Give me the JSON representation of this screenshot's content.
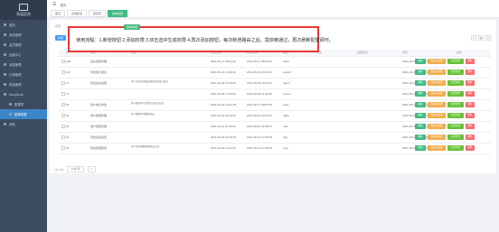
{
  "sidebar": {
    "brand": "华运后台",
    "items": [
      {
        "label": "首页",
        "active": false,
        "sub": false
      },
      {
        "label": "系统管理",
        "active": false,
        "sub": false
      },
      {
        "label": "会员管理",
        "active": false,
        "sub": false
      },
      {
        "label": "运营中心",
        "active": false,
        "sub": false
      },
      {
        "label": "消息管理",
        "active": false,
        "sub": false
      },
      {
        "label": "订单管理",
        "active": false,
        "sub": false
      },
      {
        "label": "资金管理",
        "active": false,
        "sub": false
      },
      {
        "label": "DeepBook",
        "active": false,
        "sub": false
      },
      {
        "label": "配置项",
        "active": false,
        "sub": true
      },
      {
        "label": "菜单权限",
        "active": true,
        "sub": true
      },
      {
        "label": "其他",
        "active": false,
        "sub": false
      }
    ]
  },
  "topbar": {
    "title": "首页"
  },
  "tabs": [
    {
      "label": "首页",
      "active": false
    },
    {
      "label": "系统配置",
      "active": false
    },
    {
      "label": "配置项",
      "active": false
    },
    {
      "label": "菜单权限",
      "active": true
    }
  ],
  "panel": {
    "filter_label": "名称",
    "add_label": "新增"
  },
  "callout": {
    "badge": "菜单权限",
    "text": "使用流程：1.新增按钮 2.添加权限 3.双击选中生成权限 4.再次添加按钮，每次新增路由之后，需依赖通过，再次刷新配置即可。"
  },
  "table": {
    "columns": [
      "ID",
      "名称",
      "描述",
      "创建时间",
      "更新时间",
      "路径",
      "状态",
      "权限标识",
      "排序",
      "操作"
    ],
    "rows": [
      {
        "id": "148",
        "name": "后台权限管理",
        "desc": "",
        "created": "2021-06-17 08:21:00",
        "updated": "2021-06-17 08:21:00",
        "path": "/auth",
        "status": "",
        "perm": "",
        "sort": "2021-06-17 08:21:00"
      },
      {
        "id": "147",
        "name": "导出统计报表",
        "desc": "",
        "created": "2021-05-21 15:40:26",
        "updated": "2021-05-21 15:40:26",
        "path": "/export",
        "status": "",
        "perm": "",
        "sort": "2021-05-21 15:40:26"
      },
      {
        "id": "71",
        "name": "导出后台权限",
        "desc": "用于导出后台路由权限列表的接口信息",
        "created": "2021-03-30 15:16:05",
        "updated": "2021-05-18 15:31:00",
        "path": "/perm",
        "status": "",
        "perm": "",
        "sort": "2021-05-18 15:31:00"
      },
      {
        "id": "70",
        "name": "",
        "desc": "",
        "created": "2021-03-18 17:09:04",
        "updated": "2021-05-18 11:34:05",
        "path": "/menu",
        "status": "",
        "perm": "",
        "sort": "2021-05-18 11:34:05"
      },
      {
        "id": "60",
        "name": "用户信息修改",
        "desc": "用于修改用户信息的后台接口信息",
        "created": "2021-03-18 13:21:48",
        "updated": "2021-05-17 08:57:00",
        "path": "/user",
        "status": "",
        "perm": "",
        "sort": "2021-05-17 08:57:00"
      },
      {
        "id": "61",
        "name": "用户数据管理",
        "desc": "用于管理用户数据的接口",
        "created": "2021-03-13 16:40:31",
        "updated": "2021-05-16 09:09:44",
        "path": "/data",
        "status": "",
        "perm": "",
        "sort": "2021-05-16 09:09:44"
      },
      {
        "id": "63",
        "name": "用户权限管理",
        "desc": "",
        "created": "2021-03-11 14:36:43",
        "updated": "2021-05-16 09:38:21",
        "path": "/role",
        "status": "",
        "perm": "",
        "sort": "2021-05-16 09:38:21"
      },
      {
        "id": "62",
        "name": "导出后台配置",
        "desc": "",
        "created": "2021-03-18 10:40:18",
        "updated": "2021-05-12 17:05:08",
        "path": "/cfg",
        "status": "",
        "perm": "",
        "sort": "2021-05-12 17:05:08"
      },
      {
        "id": "64",
        "name": "导出权限配置",
        "desc": "用于导出权限配置的接口信息",
        "created": "2021-01-20 11:21:02",
        "updated": "2021-05-12 17:08:08",
        "path": "/exp",
        "status": "",
        "perm": "",
        "sort": "2021-05-12 17:08:08"
      }
    ],
    "actions": {
      "edit": "编辑",
      "add_sub": "添加子权限",
      "assign": "分配角色",
      "delete": "删除"
    }
  },
  "pager": {
    "total": "共 9 条",
    "size": "10条/页",
    "page": "1"
  }
}
